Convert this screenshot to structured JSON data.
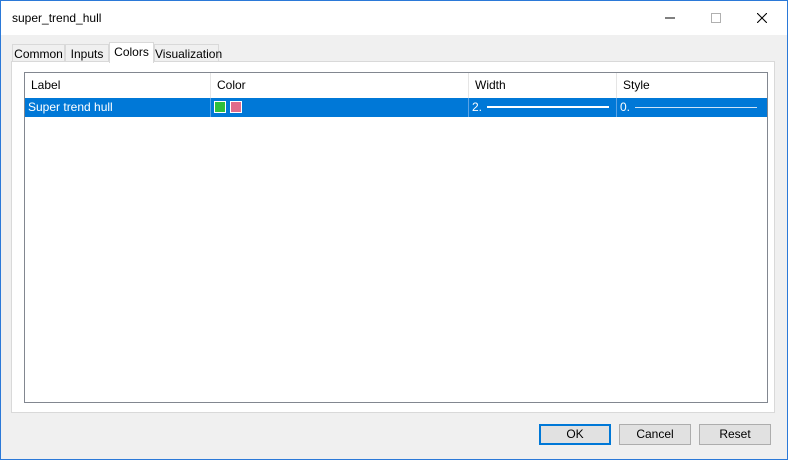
{
  "window": {
    "title": "super_trend_hull",
    "minimize_icon": "minimize-icon",
    "maximize_icon": "maximize-icon",
    "close_icon": "close-icon"
  },
  "tabs": [
    {
      "label": "Common",
      "active": false
    },
    {
      "label": "Inputs",
      "active": false
    },
    {
      "label": "Colors",
      "active": true
    },
    {
      "label": "Visualization",
      "active": false
    }
  ],
  "table": {
    "columns": [
      "Label",
      "Color",
      "Width",
      "Style"
    ],
    "rows": [
      {
        "label": "Super trend hull",
        "colors": [
          "#2fc03c",
          "#e06b8b"
        ],
        "width": "2.",
        "style": "0.",
        "selected": true
      }
    ]
  },
  "buttons": {
    "ok": "OK",
    "cancel": "Cancel",
    "reset": "Reset"
  },
  "colors": {
    "selection": "#0078d7",
    "accent_border": "#2b79d8"
  }
}
